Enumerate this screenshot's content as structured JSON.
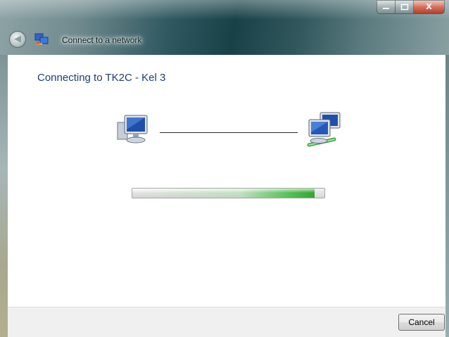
{
  "window": {
    "title": "Connect to a network",
    "caption_buttons": {
      "minimize_icon": "minimize-icon",
      "maximize_icon": "maximize-icon",
      "close_icon": "close-icon",
      "close_glyph": "X"
    },
    "back_button_icon": "back-arrow-icon",
    "back_glyph": "◀",
    "title_icon": "network-icon"
  },
  "main": {
    "heading": "Connecting to TK2C - Kel 3",
    "source_icon": "computer-icon",
    "target_icon": "network-computers-icon",
    "progress": {
      "value": 0.95,
      "accent_color": "#2fa82f"
    }
  },
  "footer": {
    "cancel_label": "Cancel"
  },
  "colors": {
    "heading_text": "#1e3d73",
    "footer_background": "#f0f0f0"
  }
}
